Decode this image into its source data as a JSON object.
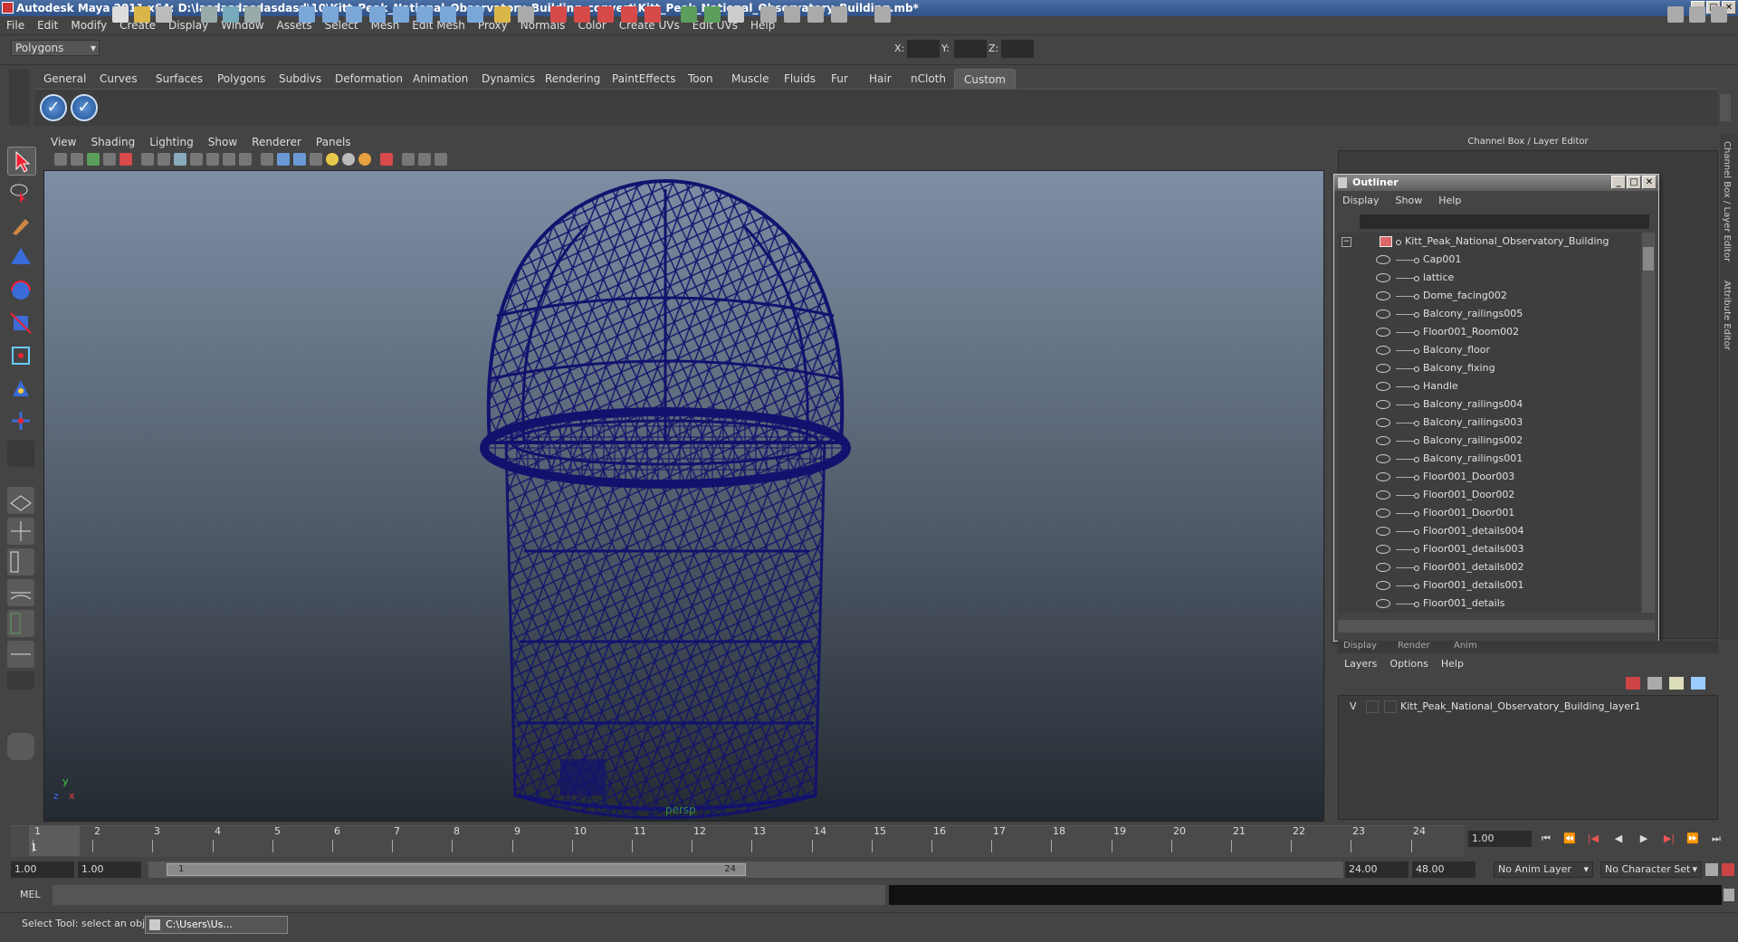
{
  "window": {
    "title": "Autodesk Maya 2011 x64: D:\\lasdasdasdasdasd\\10\\Kitt_Peak_National_Observatory_Building_convert\\Kitt_Peak_National_Observatory_Building.mb*",
    "minimize": "_",
    "maximize": "□",
    "close": "✕"
  },
  "menu": [
    "File",
    "Edit",
    "Modify",
    "Create",
    "Display",
    "Window",
    "Assets",
    "Select",
    "Mesh",
    "Edit Mesh",
    "Proxy",
    "Normals",
    "Color",
    "Create UVs",
    "Edit UVs",
    "Help"
  ],
  "status_line": {
    "mode": "Polygons",
    "x_label": "X:",
    "y_label": "Y:",
    "z_label": "Z:"
  },
  "shelf": {
    "tabs": [
      "General",
      "Curves",
      "Surfaces",
      "Polygons",
      "Subdivs",
      "Deformation",
      "Animation",
      "Dynamics",
      "Rendering",
      "PaintEffects",
      "Toon",
      "Muscle",
      "Fluids",
      "Fur",
      "Hair",
      "nCloth",
      "Custom"
    ],
    "active_tab": "Custom",
    "button_glyph": "✓"
  },
  "viewport": {
    "menu": [
      "View",
      "Shading",
      "Lighting",
      "Show",
      "Renderer",
      "Panels"
    ],
    "camera": "persp",
    "axis_x": "x",
    "axis_y": "y",
    "axis_z": "z"
  },
  "channel_box": {
    "header": "Channel Box / Layer Editor",
    "side_tabs": [
      "Channel Box / Layer Editor",
      "Attribute Editor"
    ]
  },
  "outliner": {
    "title": "Outliner",
    "menu": [
      "Display",
      "Show",
      "Help"
    ],
    "root": "Kitt_Peak_National_Observatory_Building",
    "items": [
      "Cap001",
      "lattice",
      "Dome_facing002",
      "Balcony_railings005",
      "Floor001_Room002",
      "Balcony_floor",
      "Balcony_fixing",
      "Handle",
      "Balcony_railings004",
      "Balcony_railings003",
      "Balcony_railings002",
      "Balcony_railings001",
      "Floor001_Door003",
      "Floor001_Door002",
      "Floor001_Door001",
      "Floor001_details004",
      "Floor001_details003",
      "Floor001_details002",
      "Floor001_details001",
      "Floor001_details"
    ],
    "collapse": "−"
  },
  "layer_editor": {
    "tabs": [
      "Display",
      "Render",
      "Anim"
    ],
    "menu": [
      "Layers",
      "Options",
      "Help"
    ],
    "layer_visible": "V",
    "layer_name": "Kitt_Peak_National_Observatory_Building_layer1"
  },
  "timeline": {
    "ticks": [
      "1",
      "2",
      "3",
      "4",
      "5",
      "6",
      "7",
      "8",
      "9",
      "10",
      "11",
      "12",
      "13",
      "14",
      "15",
      "16",
      "17",
      "18",
      "19",
      "20",
      "21",
      "22",
      "23",
      "24"
    ],
    "current_marker": "1",
    "current_frame": "1.00",
    "playback": [
      "⏮",
      "⏪",
      "|◀",
      "◀",
      "▶",
      "▶|",
      "⏩",
      "⏭"
    ]
  },
  "range": {
    "start": "1.00",
    "playback_start": "1.00",
    "bar_start": "1",
    "bar_end": "24",
    "playback_end": "24.00",
    "end": "48.00",
    "anim_layer": "No Anim Layer",
    "character_set": "No Character Set"
  },
  "command_line": {
    "label": "MEL"
  },
  "help_line": {
    "text": "Select Tool: select an object",
    "task": "C:\\Users\\Us..."
  },
  "colors": {
    "wireframe": "#12126e",
    "title_bar": "#2f5288",
    "panel": "#444444"
  }
}
